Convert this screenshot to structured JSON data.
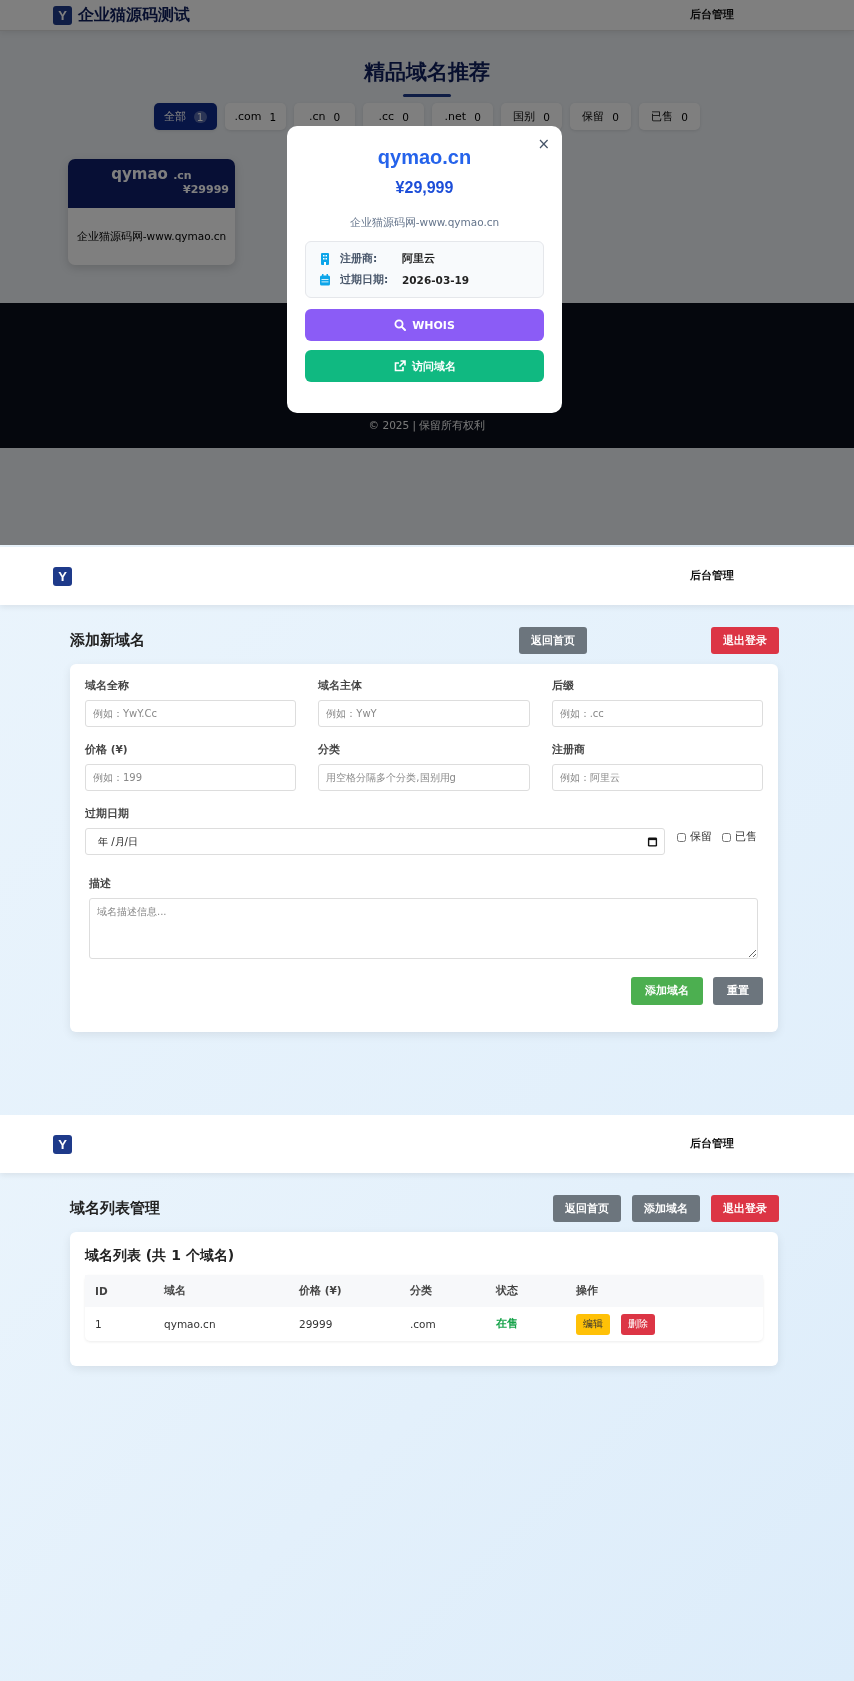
{
  "home_page": {
    "logo": {
      "letter": "Y",
      "title": "企业猫源码测试"
    },
    "nav_link": "后台管理",
    "heading": "精品域名推荐",
    "filters": [
      {
        "label": "全部",
        "count": "1",
        "selected": true
      },
      {
        "label": ".com",
        "count": "1",
        "selected": false
      },
      {
        "label": ".cn",
        "count": "0",
        "selected": false
      },
      {
        "label": ".cc",
        "count": "0",
        "selected": false
      },
      {
        "label": ".net",
        "count": "0",
        "selected": false
      },
      {
        "label": "国别",
        "count": "0",
        "selected": false
      },
      {
        "label": "保留",
        "count": "0",
        "selected": false
      },
      {
        "label": "已售",
        "count": "0",
        "selected": false
      }
    ],
    "domain_cards": [
      {
        "name": "qymao",
        "suffix": ".cn",
        "price": "¥29999",
        "description": "企业猫源码网-www.qymao.cn"
      }
    ],
    "footer": {
      "copyright": "© 2025 | 保留所有权利"
    }
  },
  "domain_modal": {
    "close": "×",
    "title": "qymao.cn",
    "price": "¥29,999",
    "description": "企业猫源码网-www.qymao.cn",
    "details": [
      {
        "kind": "registrar",
        "label": "注册商:",
        "value": "阿里云"
      },
      {
        "kind": "expiry",
        "label": "过期日期:",
        "value": "2026-03-19"
      }
    ],
    "buttons": [
      {
        "kind": "whois",
        "label": "WHOIS"
      },
      {
        "kind": "visit",
        "label": "访问域名"
      }
    ]
  },
  "add_page": {
    "logo": {
      "letter": "Y"
    },
    "nav_link": "后台管理",
    "title": "添加新域名",
    "buttons": [
      {
        "kind": "secondary",
        "label": "返回首页"
      },
      {
        "kind": "danger",
        "label": "退出登录"
      }
    ],
    "fields": [
      {
        "label": "域名全称",
        "placeholder": "例如：YwY.Cc"
      },
      {
        "label": "域名主体",
        "placeholder": "例如：YwY"
      },
      {
        "label": "后缀",
        "placeholder": "例如：.cc"
      },
      {
        "label": "价格 (¥)",
        "placeholder": "例如：199"
      },
      {
        "label": "分类",
        "placeholder": "用空格分隔多个分类,国别用g"
      },
      {
        "label": "注册商",
        "placeholder": "例如：阿里云"
      }
    ],
    "date_field": {
      "label": "过期日期",
      "value": "年 /月/日"
    },
    "checkboxes": [
      {
        "label": "保留",
        "checked": false
      },
      {
        "label": "已售",
        "checked": false
      }
    ],
    "description": {
      "label": "描述",
      "placeholder": "域名描述信息..."
    },
    "form_buttons": [
      {
        "kind": "success",
        "label": "添加域名"
      },
      {
        "kind": "secondary",
        "label": "重置"
      }
    ]
  },
  "list_page": {
    "logo": {
      "letter": "Y"
    },
    "nav_link": "后台管理",
    "title": "域名列表管理",
    "buttons": [
      {
        "kind": "secondary",
        "label": "返回首页"
      },
      {
        "kind": "secondary",
        "label": "添加域名"
      },
      {
        "kind": "danger",
        "label": "退出登录"
      }
    ],
    "table": {
      "title": "域名列表 (共 1 个域名)",
      "columns": [
        "ID",
        "域名",
        "价格 (¥)",
        "分类",
        "状态",
        "操作"
      ],
      "rows": [
        {
          "id": "1",
          "domain": "qymao.cn",
          "price": "29999",
          "category": ".com",
          "status": {
            "kind": "on_sale",
            "text": "在售"
          },
          "actions": [
            {
              "kind": "warning",
              "label": "编辑"
            },
            {
              "kind": "danger",
              "label": "删除"
            }
          ]
        }
      ]
    }
  }
}
